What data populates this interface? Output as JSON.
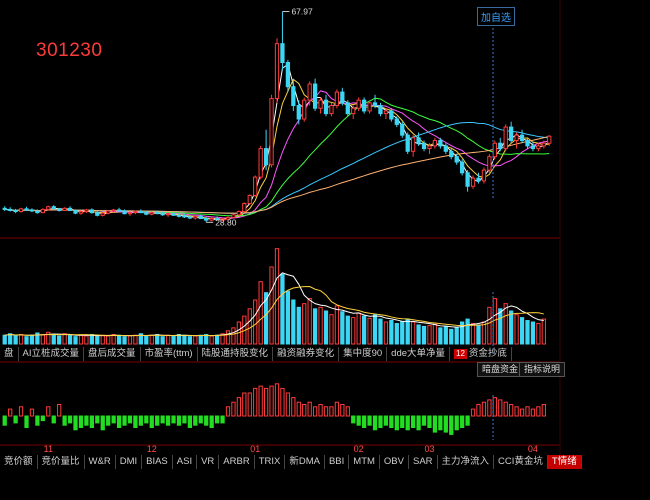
{
  "stock_code": "301230",
  "add_self_label": "加自选",
  "price_high_label": "67.97",
  "price_low_label": "28.80",
  "mid_tabs": [
    {
      "label": "盘",
      "active": false
    },
    {
      "label": "AI立桩成交量",
      "active": false
    },
    {
      "label": "盘后成交量",
      "active": false
    },
    {
      "label": "市盈率(ttm)",
      "active": false
    },
    {
      "label": "陆股通持股变化",
      "active": false
    },
    {
      "label": "融资融券变化",
      "active": false
    },
    {
      "label": "集中度90",
      "active": false
    },
    {
      "label": "dde大单净量",
      "active": false
    },
    {
      "label": "资金抄底",
      "active": false,
      "badge": "12"
    }
  ],
  "mid_right_buttons": [
    "暗盘资金",
    "指标说明"
  ],
  "bottom_tabs": [
    {
      "label": "竞价额",
      "active": false
    },
    {
      "label": "竞价量比",
      "active": false
    },
    {
      "label": "W&R",
      "active": false
    },
    {
      "label": "DMI",
      "active": false
    },
    {
      "label": "BIAS",
      "active": false
    },
    {
      "label": "ASI",
      "active": false
    },
    {
      "label": "VR",
      "active": false
    },
    {
      "label": "ARBR",
      "active": false
    },
    {
      "label": "TRIX",
      "active": false
    },
    {
      "label": "新DMA",
      "active": false
    },
    {
      "label": "BBI",
      "active": false
    },
    {
      "label": "MTM",
      "active": false
    },
    {
      "label": "OBV",
      "active": false
    },
    {
      "label": "SAR",
      "active": false
    },
    {
      "label": "主力净流入",
      "active": false
    },
    {
      "label": "CCI黄金坑",
      "active": false
    },
    {
      "label": "T情绪",
      "active": true
    }
  ],
  "chart_data": {
    "type": "candlestick",
    "month_labels": [
      "11",
      "12",
      "01",
      "02",
      "03",
      "04"
    ],
    "month_label_index": [
      8,
      27,
      46,
      65,
      78,
      97
    ],
    "candles": [
      [
        31.4,
        31.8,
        30.9,
        31.2
      ],
      [
        31.2,
        31.6,
        30.8,
        31.0
      ],
      [
        31.0,
        31.3,
        30.5,
        30.8
      ],
      [
        30.8,
        31.5,
        30.6,
        31.3
      ],
      [
        31.3,
        31.7,
        30.9,
        31.1
      ],
      [
        31.1,
        31.4,
        30.7,
        30.9
      ],
      [
        30.9,
        31.2,
        30.4,
        30.6
      ],
      [
        30.6,
        31.4,
        30.5,
        31.2
      ],
      [
        31.2,
        31.9,
        31.0,
        31.7
      ],
      [
        31.7,
        32.0,
        31.1,
        31.3
      ],
      [
        31.3,
        31.5,
        30.8,
        31.0
      ],
      [
        31.0,
        31.6,
        30.9,
        31.4
      ],
      [
        31.4,
        31.8,
        30.9,
        31.0
      ],
      [
        31.0,
        31.2,
        30.3,
        30.5
      ],
      [
        30.5,
        31.0,
        30.2,
        30.8
      ],
      [
        30.8,
        31.3,
        30.5,
        31.1
      ],
      [
        31.1,
        31.4,
        30.4,
        30.6
      ],
      [
        30.6,
        30.9,
        29.9,
        30.1
      ],
      [
        30.1,
        30.7,
        29.9,
        30.5
      ],
      [
        30.5,
        31.1,
        30.3,
        30.9
      ],
      [
        30.9,
        31.3,
        30.6,
        31.1
      ],
      [
        31.1,
        31.5,
        30.7,
        30.9
      ],
      [
        30.9,
        31.2,
        30.3,
        30.4
      ],
      [
        30.4,
        30.8,
        30.0,
        30.6
      ],
      [
        30.6,
        31.0,
        30.3,
        30.8
      ],
      [
        30.8,
        31.2,
        30.5,
        30.6
      ],
      [
        30.6,
        30.9,
        30.1,
        30.3
      ],
      [
        30.3,
        30.8,
        30.1,
        30.6
      ],
      [
        30.6,
        31.0,
        30.3,
        30.5
      ],
      [
        30.5,
        30.8,
        30.0,
        30.2
      ],
      [
        30.2,
        30.6,
        29.8,
        30.4
      ],
      [
        30.4,
        30.7,
        30.0,
        30.1
      ],
      [
        30.1,
        30.5,
        29.7,
        30.0
      ],
      [
        30.0,
        30.4,
        29.6,
        29.8
      ],
      [
        29.8,
        30.2,
        29.4,
        29.6
      ],
      [
        29.6,
        30.0,
        29.3,
        29.9
      ],
      [
        29.9,
        30.2,
        29.4,
        29.5
      ],
      [
        29.5,
        29.8,
        28.8,
        29.2
      ],
      [
        29.2,
        29.7,
        29.0,
        29.5
      ],
      [
        29.5,
        29.9,
        29.1,
        29.3
      ],
      [
        29.3,
        29.6,
        29.0,
        29.4
      ],
      [
        29.4,
        29.9,
        29.2,
        29.7
      ],
      [
        29.7,
        30.4,
        29.5,
        30.2
      ],
      [
        30.2,
        31.0,
        30.0,
        30.8
      ],
      [
        30.8,
        32.5,
        30.6,
        32.3
      ],
      [
        32.3,
        34.0,
        32.0,
        33.8
      ],
      [
        33.8,
        37.5,
        33.5,
        37.2
      ],
      [
        37.2,
        43.0,
        36.8,
        42.5
      ],
      [
        42.5,
        46.0,
        38.5,
        39.5
      ],
      [
        39.5,
        52.5,
        39.0,
        51.8
      ],
      [
        51.8,
        63.0,
        51.0,
        62.0
      ],
      [
        62.0,
        67.97,
        57.0,
        58.5
      ],
      [
        58.5,
        59.0,
        53.0,
        54.0
      ],
      [
        54.0,
        55.5,
        49.5,
        50.5
      ],
      [
        50.5,
        51.5,
        47.0,
        48.0
      ],
      [
        48.0,
        52.0,
        47.5,
        51.5
      ],
      [
        51.5,
        55.0,
        50.5,
        54.5
      ],
      [
        54.5,
        55.5,
        49.5,
        50.0
      ],
      [
        50.0,
        52.0,
        49.0,
        51.5
      ],
      [
        51.5,
        52.5,
        48.5,
        49.0
      ],
      [
        49.0,
        51.0,
        48.5,
        50.5
      ],
      [
        50.5,
        53.5,
        50.0,
        53.0
      ],
      [
        53.0,
        53.8,
        50.5,
        51.0
      ],
      [
        51.0,
        51.5,
        48.5,
        49.0
      ],
      [
        49.0,
        50.5,
        48.0,
        50.0
      ],
      [
        50.0,
        52.0,
        49.5,
        51.5
      ],
      [
        51.5,
        52.0,
        49.0,
        49.5
      ],
      [
        49.5,
        51.5,
        49.0,
        51.0
      ],
      [
        51.0,
        52.5,
        50.0,
        50.5
      ],
      [
        50.5,
        51.0,
        48.5,
        49.0
      ],
      [
        49.0,
        50.0,
        48.0,
        49.5
      ],
      [
        49.5,
        50.0,
        47.5,
        48.0
      ],
      [
        48.0,
        48.5,
        46.5,
        47.0
      ],
      [
        47.0,
        47.5,
        44.5,
        45.0
      ],
      [
        45.0,
        45.5,
        41.5,
        42.0
      ],
      [
        42.0,
        45.0,
        41.0,
        44.5
      ],
      [
        44.5,
        45.5,
        43.0,
        43.5
      ],
      [
        43.5,
        44.0,
        42.0,
        42.5
      ],
      [
        42.5,
        43.5,
        41.5,
        43.0
      ],
      [
        43.0,
        44.5,
        42.5,
        44.0
      ],
      [
        44.0,
        44.5,
        42.5,
        43.0
      ],
      [
        43.0,
        43.5,
        41.5,
        42.0
      ],
      [
        42.0,
        42.5,
        40.5,
        41.0
      ],
      [
        41.0,
        41.5,
        39.5,
        40.0
      ],
      [
        40.0,
        40.5,
        37.5,
        38.0
      ],
      [
        38.0,
        38.5,
        34.5,
        35.5
      ],
      [
        35.5,
        37.5,
        35.0,
        37.0
      ],
      [
        37.0,
        38.0,
        36.0,
        36.5
      ],
      [
        36.5,
        39.0,
        36.0,
        38.5
      ],
      [
        38.5,
        41.5,
        38.0,
        41.0
      ],
      [
        41.0,
        44.0,
        40.5,
        43.5
      ],
      [
        43.5,
        44.5,
        42.0,
        42.5
      ],
      [
        42.5,
        47.0,
        42.0,
        46.5
      ],
      [
        46.5,
        47.5,
        43.5,
        44.0
      ],
      [
        44.0,
        45.5,
        42.5,
        45.0
      ],
      [
        45.0,
        46.0,
        43.5,
        44.0
      ],
      [
        44.0,
        44.5,
        42.5,
        43.0
      ],
      [
        43.0,
        43.8,
        42.0,
        42.5
      ],
      [
        42.5,
        43.5,
        42.0,
        43.0
      ],
      [
        43.0,
        44.0,
        42.5,
        43.5
      ],
      [
        43.5,
        45.0,
        43.0,
        44.8
      ]
    ],
    "volumes": [
      12,
      14,
      11,
      13,
      10,
      12,
      15,
      13,
      16,
      12,
      11,
      14,
      13,
      10,
      12,
      11,
      13,
      10,
      12,
      11,
      13,
      12,
      10,
      11,
      12,
      14,
      11,
      12,
      13,
      10,
      12,
      11,
      13,
      12,
      10,
      11,
      12,
      13,
      11,
      12,
      14,
      18,
      22,
      30,
      38,
      48,
      60,
      85,
      70,
      105,
      130,
      95,
      72,
      60,
      50,
      55,
      62,
      48,
      50,
      45,
      40,
      52,
      44,
      38,
      36,
      42,
      38,
      35,
      40,
      34,
      30,
      32,
      28,
      30,
      34,
      30,
      26,
      24,
      25,
      27,
      22,
      24,
      20,
      22,
      30,
      34,
      28,
      26,
      30,
      50,
      62,
      48,
      55,
      45,
      40,
      36,
      32,
      30,
      28,
      34
    ],
    "indicator": [
      -4,
      3,
      -3,
      4,
      -5,
      3,
      -4,
      -2,
      4,
      -3,
      5,
      -4,
      -3,
      -6,
      -5,
      -4,
      -5,
      -3,
      -6,
      -4,
      -3,
      -5,
      -4,
      -3,
      -5,
      -4,
      -3,
      -5,
      -4,
      -3,
      -4,
      -3,
      -4,
      -3,
      -5,
      -4,
      -3,
      -4,
      -5,
      -3,
      -3,
      4,
      6,
      8,
      10,
      10,
      12,
      13,
      12,
      13,
      14,
      12,
      10,
      8,
      6,
      5,
      6,
      4,
      5,
      4,
      4,
      6,
      5,
      4,
      -3,
      -4,
      -5,
      -4,
      -6,
      -5,
      -4,
      -5,
      -6,
      -5,
      -6,
      -5,
      -6,
      -4,
      -5,
      -7,
      -6,
      -7,
      -8,
      -6,
      -5,
      -4,
      3,
      5,
      6,
      7,
      8,
      7,
      6,
      5,
      4,
      3,
      4,
      3,
      4,
      5
    ],
    "ma_colors": [
      "#ffffff",
      "#ffd23c",
      "#ff55ff",
      "#3cff3c",
      "#3cc8ff",
      "#ffb070"
    ]
  },
  "colors": {
    "up": "#ff3b3b",
    "down": "#3dd6f5",
    "ind_up": "#ff3b3b",
    "ind_down": "#22dd22",
    "grid": "#7a0000",
    "axis_text": "#ff4a4a"
  }
}
